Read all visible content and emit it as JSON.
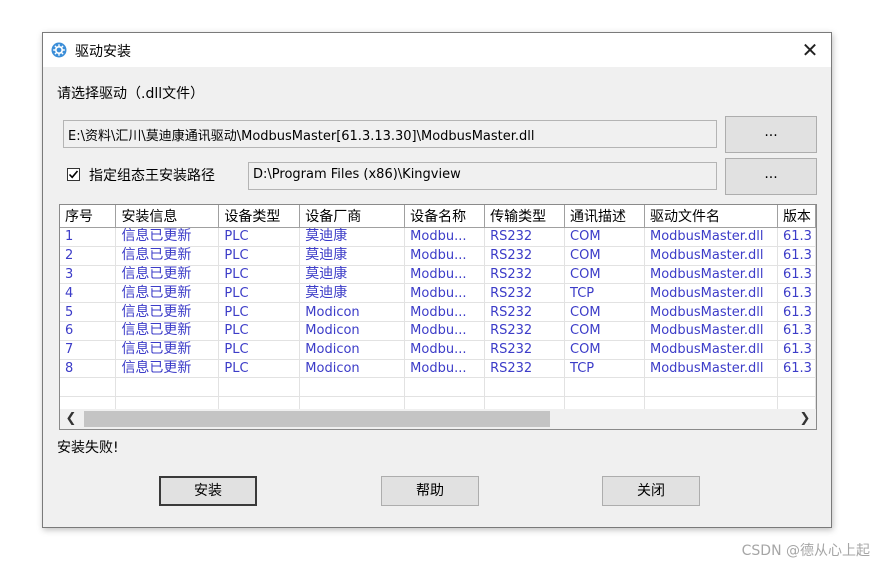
{
  "window": {
    "title": "驱动安装",
    "close_label": "✕",
    "colors": {
      "title_bar": "#ffffff",
      "body": "#f0f0f0",
      "row_text": "#3c3cc8"
    }
  },
  "select_driver": {
    "label": "请选择驱动（.dll文件）",
    "path_value": "E:\\资料\\汇川\\莫迪康通讯驱动\\ModbusMaster[61.3.13.30]\\ModbusMaster.dll",
    "browse_label": "..."
  },
  "install_path": {
    "checkbox_checked": true,
    "label": "指定组态王安装路径",
    "path_value": "D:\\Program Files (x86)\\Kingview",
    "browse_label": "..."
  },
  "grid": {
    "columns": [
      "序号",
      "安装信息",
      "设备类型",
      "设备厂商",
      "设备名称",
      "传输类型",
      "通讯描述",
      "驱动文件名",
      "版本"
    ],
    "rows": [
      [
        "1",
        "信息已更新",
        "PLC",
        "莫迪康",
        "Modbu...",
        "RS232",
        "COM",
        "ModbusMaster.dll",
        "61.3"
      ],
      [
        "2",
        "信息已更新",
        "PLC",
        "莫迪康",
        "Modbu...",
        "RS232",
        "COM",
        "ModbusMaster.dll",
        "61.3"
      ],
      [
        "3",
        "信息已更新",
        "PLC",
        "莫迪康",
        "Modbu...",
        "RS232",
        "COM",
        "ModbusMaster.dll",
        "61.3"
      ],
      [
        "4",
        "信息已更新",
        "PLC",
        "莫迪康",
        "Modbu...",
        "RS232",
        "TCP",
        "ModbusMaster.dll",
        "61.3"
      ],
      [
        "5",
        "信息已更新",
        "PLC",
        "Modicon",
        "Modbu...",
        "RS232",
        "COM",
        "ModbusMaster.dll",
        "61.3"
      ],
      [
        "6",
        "信息已更新",
        "PLC",
        "Modicon",
        "Modbu...",
        "RS232",
        "COM",
        "ModbusMaster.dll",
        "61.3"
      ],
      [
        "7",
        "信息已更新",
        "PLC",
        "Modicon",
        "Modbu...",
        "RS232",
        "COM",
        "ModbusMaster.dll",
        "61.3"
      ],
      [
        "8",
        "信息已更新",
        "PLC",
        "Modicon",
        "Modbu...",
        "RS232",
        "TCP",
        "ModbusMaster.dll",
        "61.3"
      ]
    ],
    "scroll_left_icon": "chevron-left-icon",
    "scroll_right_icon": "chevron-right-icon"
  },
  "status": {
    "text": "安装失败!"
  },
  "buttons": {
    "install": "安装",
    "help": "帮助",
    "close": "关闭"
  },
  "watermark": "CSDN @德从心上起"
}
